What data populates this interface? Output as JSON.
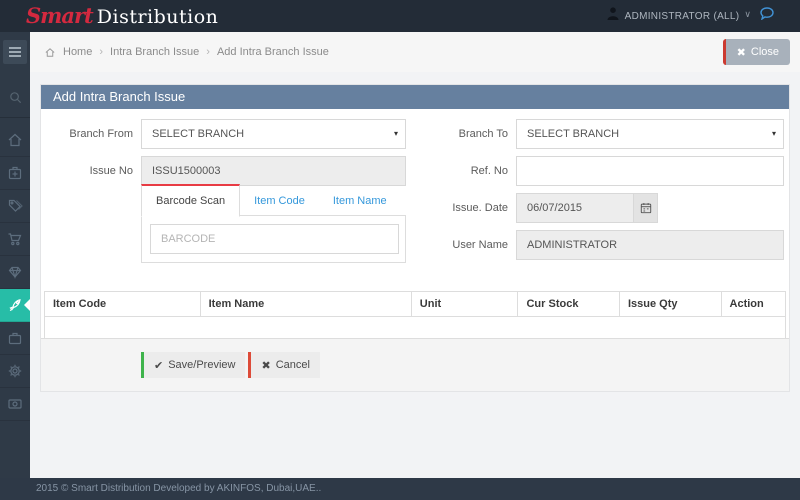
{
  "navbar": {
    "logo_primary": "Smart",
    "logo_secondary": "Distribution",
    "user_label": "ADMINISTRATOR (ALL)"
  },
  "breadcrumb": {
    "items": [
      "Home",
      "Intra Branch Issue",
      "Add Intra Branch Issue"
    ],
    "separator": "›",
    "close_label": "Close"
  },
  "panel": {
    "title": "Add Intra Branch Issue"
  },
  "form": {
    "branch_from": {
      "label": "Branch From",
      "value": "SELECT BRANCH"
    },
    "branch_to": {
      "label": "Branch To",
      "value": "SELECT BRANCH"
    },
    "issue_no": {
      "label": "Issue No",
      "value": "ISSU1500003"
    },
    "ref_no": {
      "label": "Ref. No",
      "value": ""
    },
    "issue_date": {
      "label": "Issue. Date",
      "value": "06/07/2015"
    },
    "user_name": {
      "label": "User Name",
      "value": "ADMINISTRATOR"
    },
    "tabs": [
      {
        "label": "Barcode Scan",
        "active": true
      },
      {
        "label": "Item Code",
        "active": false
      },
      {
        "label": "Item Name",
        "active": false
      }
    ],
    "barcode_placeholder": "BARCODE"
  },
  "table": {
    "headers": [
      "Item Code",
      "Item Name",
      "Unit",
      "Cur Stock",
      "Issue Qty",
      "Action"
    ],
    "rows": []
  },
  "actions": {
    "save_label": "Save/Preview",
    "cancel_label": "Cancel"
  },
  "footer": {
    "copyright": "2015 © Smart Distribution Developed by AKINFOS, Dubai,UAE.."
  },
  "icons": {
    "close_x": "✖",
    "check": "✔",
    "caret_down": "▾",
    "chevron_down": "∨",
    "sidebar_items": [
      "menu-icon",
      "search-icon",
      "home-icon",
      "medkit-icon",
      "tags-icon",
      "cart-icon",
      "diamond-icon",
      "rocket-icon",
      "briefcase-icon",
      "gear-icon",
      "banknote-icon"
    ]
  },
  "colors": {
    "navbar_bg": "#232c37",
    "sidebar_bg": "#2f3a47",
    "active_teal": "#27bda7",
    "panel_header": "#66809f",
    "accent_red": "#e83b44",
    "logo_red": "#d4293f",
    "save_green": "#3eb34b",
    "cancel_red": "#dd4b39"
  }
}
